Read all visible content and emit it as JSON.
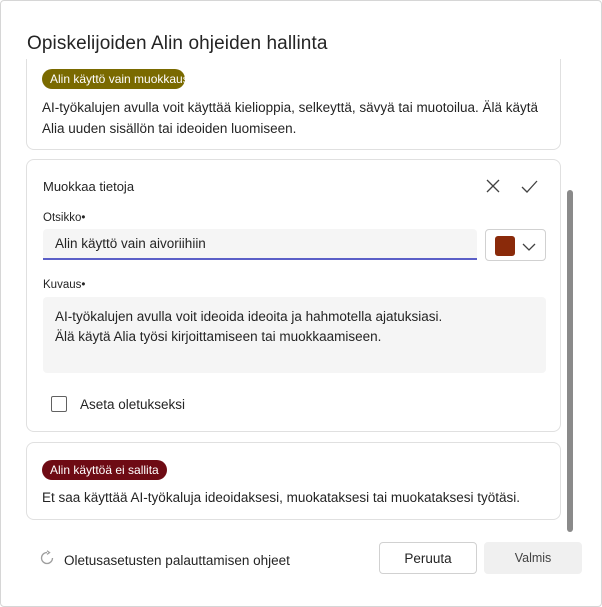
{
  "dialog": {
    "title": "Opiskelijoiden Alin ohjeiden hallinta"
  },
  "cards": {
    "modify_only": {
      "badge": "Alin käyttö vain muokkaus",
      "badge_color": "#7a6a00",
      "text": "AI-työkalujen avulla voit käyttää kielioppia, selkeyttä, sävyä tai muotoilua. Älä käytä Alia uuden sisällön tai ideoiden luomiseen."
    },
    "edit": {
      "heading": "Muokkaa tietoja",
      "close_icon": "close-icon",
      "confirm_icon": "checkmark-icon",
      "title_label": "Otsikko•",
      "title_value": "Alin käyttö vain aivoriihiin",
      "color_value": "#8a2a0a",
      "description_label": "Kuvaus•",
      "description_line1": "AI-työkalujen avulla voit ideoida ideoita ja hahmotella ajatuksiasi.",
      "description_line2": "Älä käytä Alia työsi kirjoittamiseen tai muokkaamiseen.",
      "default_checkbox_label": "Aseta oletukseksi",
      "default_checked": false
    },
    "not_allowed": {
      "badge": "Alin käyttöä ei sallita",
      "badge_color": "#6e0b14",
      "text": "Et saa käyttää AI-työkaluja ideoidaksesi, muokataksesi tai muokataksesi työtäsi."
    }
  },
  "footer": {
    "reset_label": "Oletusasetusten palauttamisen ohjeet",
    "cancel_label": "Peruuta",
    "done_label": "Valmis"
  },
  "colors": {
    "accent": "#5b5fc7"
  }
}
